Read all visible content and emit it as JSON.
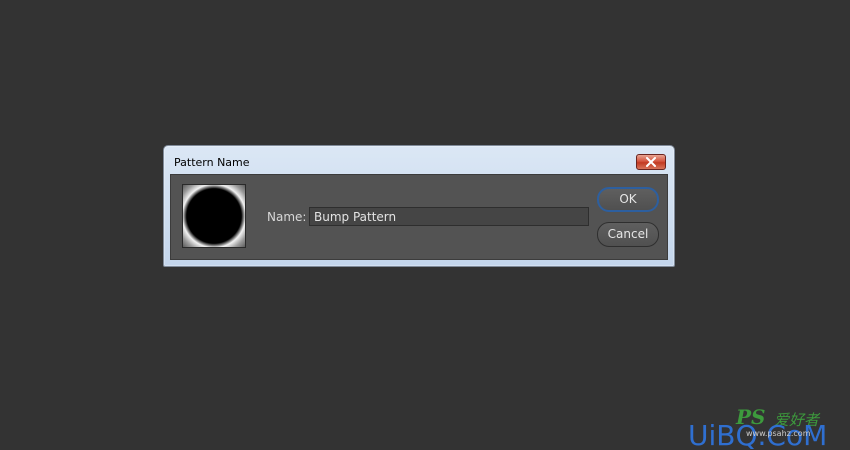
{
  "dialog": {
    "title": "Pattern Name",
    "name_label": "Name:",
    "name_value": "Bump Pattern",
    "ok_label": "OK",
    "cancel_label": "Cancel"
  },
  "watermark": {
    "ps": "PS",
    "cn": "爱好者",
    "main": "UiBQ.CoM",
    "small": "www.psahz.com"
  },
  "colors": {
    "background": "#333333",
    "dialog_frame": "#c4d6ec",
    "client": "#535353",
    "close_button": "#c23a22",
    "ok_focus": "#2d5f9f",
    "watermark_blue": "#2f6fd0",
    "watermark_green": "#3d9a3d"
  },
  "icons": {
    "close": "close-x-icon",
    "pattern": "bump-pattern-thumbnail"
  }
}
